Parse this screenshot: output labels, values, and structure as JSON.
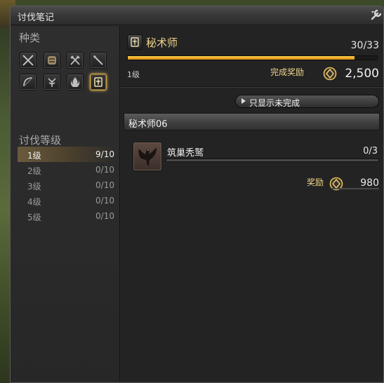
{
  "window": {
    "title": "讨伐笔记"
  },
  "sidebar": {
    "category_heading": "种类",
    "classes": [
      {
        "icon": "crossed-swords-icon"
      },
      {
        "icon": "scroll-icon"
      },
      {
        "icon": "crossed-axes-icon"
      },
      {
        "icon": "lance-icon"
      },
      {
        "icon": "bow-icon"
      },
      {
        "icon": "tree-icon"
      },
      {
        "icon": "flame-icon"
      },
      {
        "icon": "arcanist-book-icon",
        "selected": true
      }
    ],
    "level_heading": "讨伐等级",
    "levels": [
      {
        "name": "1级",
        "count": "9/10",
        "selected": true
      },
      {
        "name": "2级",
        "count": "0/10"
      },
      {
        "name": "3级",
        "count": "0/10"
      },
      {
        "name": "4级",
        "count": "0/10"
      },
      {
        "name": "5级",
        "count": "0/10"
      }
    ]
  },
  "main": {
    "class_title": "秘术师",
    "class_icon": "arcanist-book-icon",
    "progress_text": "30/33",
    "progress_fraction": 0.91,
    "rank": "1级",
    "completion_reward_label": "完成奖励",
    "completion_reward_value": "2,500",
    "reward_icon": "seal-icon",
    "filter_button": "只显示未完成",
    "group": "秘术师06",
    "entries": [
      {
        "name": "筑巢秃鹫",
        "count": "0/3",
        "progress_fraction": 0,
        "icon": "vulture-icon",
        "reward_label": "奖励",
        "reward_value": "980"
      }
    ]
  },
  "colors": {
    "accent_gold": "#f0d48a",
    "bar_fill": "#ffd24a",
    "panel_bg": "#262626"
  }
}
